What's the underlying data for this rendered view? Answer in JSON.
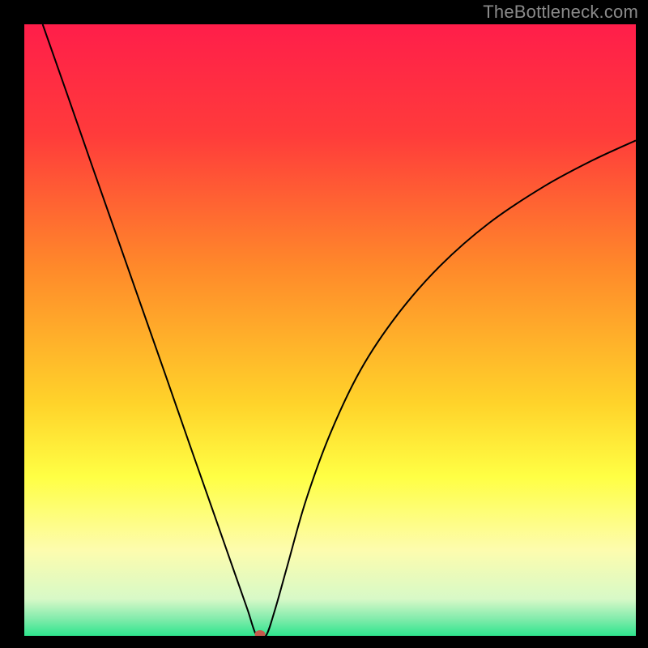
{
  "watermark": "TheBottleneck.com",
  "chart_data": {
    "type": "line",
    "title": "",
    "xlabel": "",
    "ylabel": "",
    "xlim": [
      0,
      100
    ],
    "ylim": [
      0,
      100
    ],
    "marker": {
      "x": 38.5,
      "y": 0
    },
    "gradient_stops": [
      {
        "pct": 0,
        "color": "#ff1e4a"
      },
      {
        "pct": 18,
        "color": "#ff3b3b"
      },
      {
        "pct": 40,
        "color": "#ff8a2a"
      },
      {
        "pct": 62,
        "color": "#ffd32a"
      },
      {
        "pct": 74,
        "color": "#ffff44"
      },
      {
        "pct": 86,
        "color": "#fdfcae"
      },
      {
        "pct": 94,
        "color": "#d7f9c7"
      },
      {
        "pct": 97,
        "color": "#88ecae"
      },
      {
        "pct": 100,
        "color": "#2ee58d"
      }
    ],
    "series": [
      {
        "name": "bottleneck-curve",
        "x": [
          3,
          7,
          11,
          15,
          19,
          23,
          27,
          31,
          34.5,
          36.5,
          38,
          39.5,
          41,
          43,
          46,
          50,
          55,
          61,
          68,
          76,
          85,
          93,
          100
        ],
        "y": [
          100,
          88.6,
          77.1,
          65.7,
          54.3,
          42.9,
          31.4,
          20,
          10,
          4.3,
          0,
          0,
          4.3,
          11.4,
          22,
          33,
          43.5,
          52.5,
          60.5,
          67.5,
          73.5,
          77.8,
          81
        ]
      }
    ]
  }
}
